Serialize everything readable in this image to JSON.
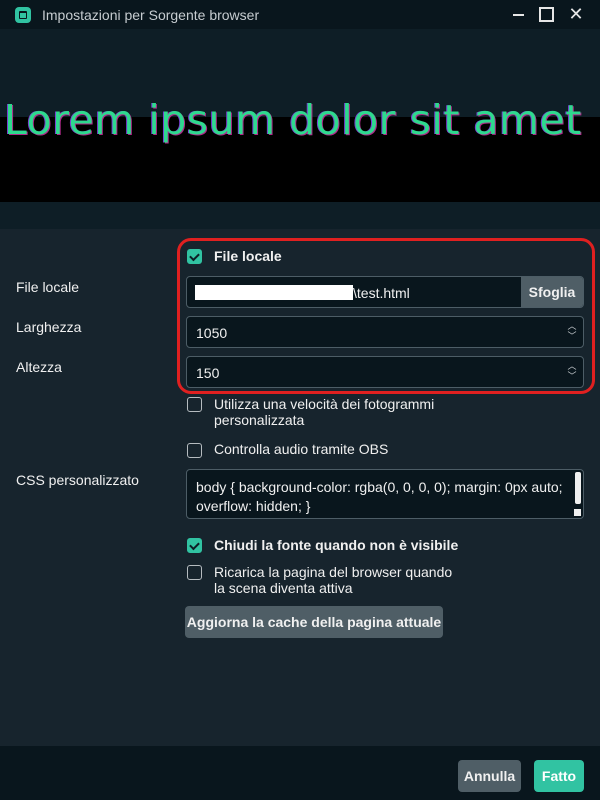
{
  "window": {
    "title": "Impostazioni per Sorgente browser",
    "icon": "app-icon",
    "close_glyph": "✕"
  },
  "preview": {
    "text": "Lorem ipsum dolor sit amet"
  },
  "form": {
    "local_file_checkbox": {
      "label": "File locale",
      "checked": true
    },
    "local_file": {
      "label": "File locale",
      "value": "\\test.html",
      "browse_label": "Sfoglia"
    },
    "width": {
      "label": "Larghezza",
      "value": "1050"
    },
    "height": {
      "label": "Altezza",
      "value": "150"
    },
    "custom_fps": {
      "label_line1": "Utilizza una velocità dei fotogrammi",
      "label_line2": "personalizzata",
      "checked": false
    },
    "control_audio": {
      "label": "Controlla audio tramite OBS",
      "checked": false
    },
    "custom_css": {
      "label": "CSS personalizzato",
      "value": "body { background-color: rgba(0, 0, 0, 0); margin: 0px auto; overflow: hidden; }"
    },
    "shutdown_when_hidden": {
      "label": "Chiudi la fonte quando non è visibile",
      "checked": true
    },
    "refresh_on_active": {
      "label_line1": "Ricarica la pagina del browser quando",
      "label_line2": "la scena diventa attiva",
      "checked": false
    },
    "refresh_cache_button": "Aggiorna la cache della pagina attuale"
  },
  "footer": {
    "cancel_label": "Annulla",
    "done_label": "Fatto"
  },
  "colors": {
    "accent": "#31c3a2",
    "highlight": "#e02020",
    "background": "#17242d"
  }
}
